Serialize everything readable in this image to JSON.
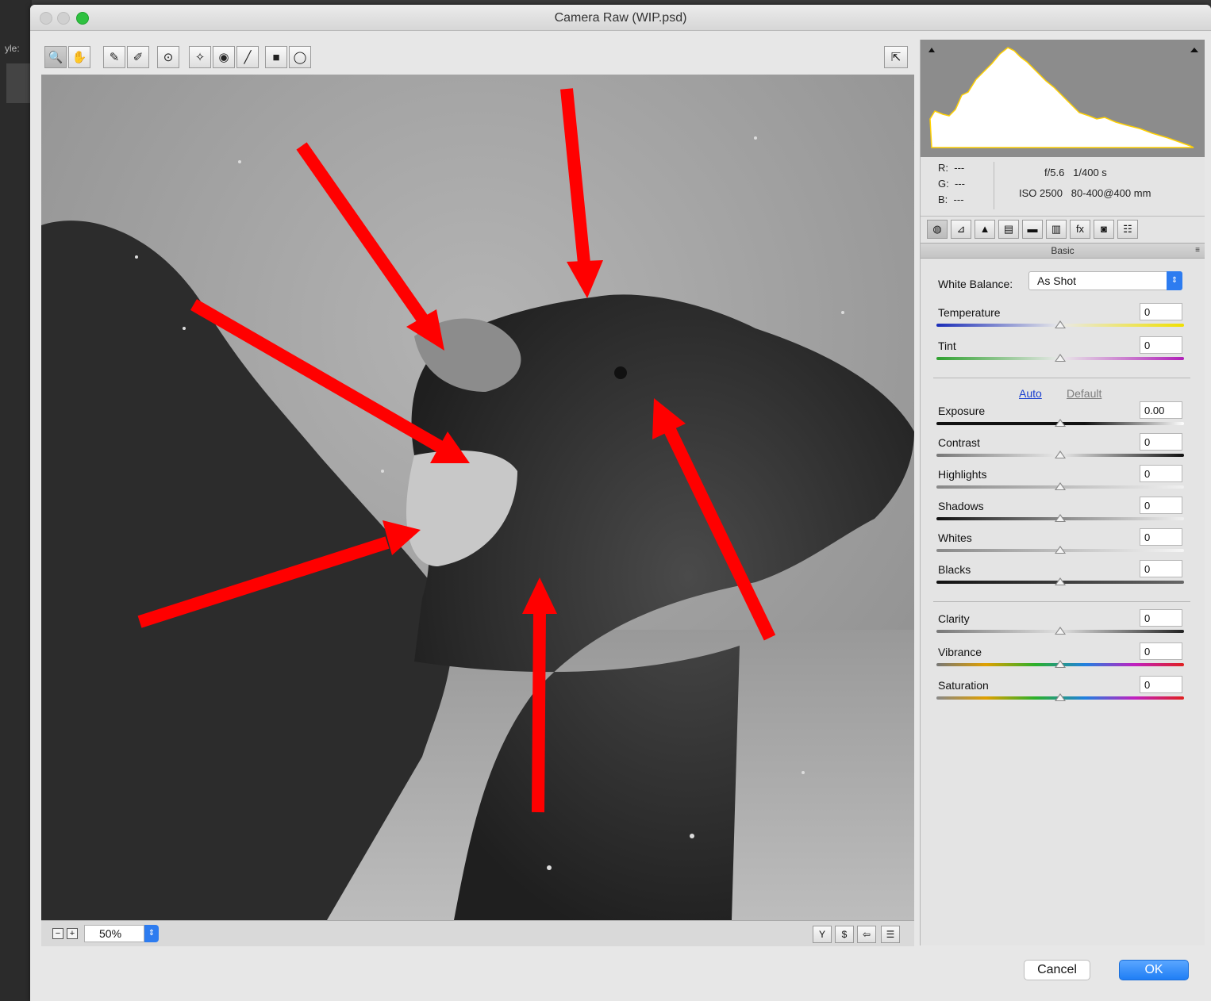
{
  "backdrop": {
    "label": "yle:"
  },
  "window": {
    "title": "Camera Raw (WIP.psd)"
  },
  "toolbar": {
    "tools": [
      {
        "icon": "zoom-tool-icon",
        "glyph": "🔍"
      },
      {
        "icon": "hand-tool-icon",
        "glyph": "✋"
      },
      {
        "icon": "white-balance-tool-icon",
        "glyph": "✎"
      },
      {
        "icon": "color-sampler-tool-icon",
        "glyph": "✐"
      },
      {
        "icon": "targeted-adjustment-tool-icon",
        "glyph": "⊙"
      },
      {
        "icon": "spot-removal-tool-icon",
        "glyph": "✧"
      },
      {
        "icon": "red-eye-tool-icon",
        "glyph": "◉"
      },
      {
        "icon": "adjustment-brush-icon",
        "glyph": "╱"
      },
      {
        "icon": "graduated-filter-icon",
        "glyph": "■"
      },
      {
        "icon": "radial-filter-icon",
        "glyph": "◯"
      }
    ],
    "preview_toggle_glyph": "⇱"
  },
  "preview": {
    "zoom_out_glyph": "−",
    "zoom_in_glyph": "+",
    "zoom_value": "50%",
    "zoom_step_glyph": "⇕",
    "view_buttons": [
      "Y",
      "$",
      "⇦",
      "☰"
    ]
  },
  "panel": {
    "readout": {
      "r_label": "R:",
      "r_value": "---",
      "g_label": "G:",
      "g_value": "---",
      "b_label": "B:",
      "b_value": "---",
      "aperture": "f/5.6",
      "shutter": "1/400 s",
      "iso": "ISO 2500",
      "lens": "80-400@400 mm"
    },
    "tabs": [
      "◍",
      "⊿",
      "▲",
      "▤",
      "▬",
      "▥",
      "fx",
      "◙",
      "☷"
    ],
    "section_title": "Basic",
    "section_menu_glyph": "≡",
    "white_balance": {
      "label": "White Balance:",
      "value": "As Shot",
      "step_glyph": "⇕"
    },
    "auto_label": "Auto",
    "default_label": "Default",
    "sliders": [
      {
        "label": "Temperature",
        "value": "0",
        "position": 0.5
      },
      {
        "label": "Tint",
        "value": "0",
        "position": 0.5
      },
      {
        "label": "Exposure",
        "value": "0.00",
        "position": 0.5
      },
      {
        "label": "Contrast",
        "value": "0",
        "position": 0.5
      },
      {
        "label": "Highlights",
        "value": "0",
        "position": 0.5
      },
      {
        "label": "Shadows",
        "value": "0",
        "position": 0.5
      },
      {
        "label": "Whites",
        "value": "0",
        "position": 0.5
      },
      {
        "label": "Blacks",
        "value": "0",
        "position": 0.5
      },
      {
        "label": "Clarity",
        "value": "0",
        "position": 0.5
      },
      {
        "label": "Vibrance",
        "value": "0",
        "position": 0.5
      },
      {
        "label": "Saturation",
        "value": "0",
        "position": 0.5
      }
    ]
  },
  "buttons": {
    "cancel": "Cancel",
    "ok": "OK"
  },
  "colors": {
    "accent": "#2d7cf0",
    "annotation_arrow": "#ff0000"
  }
}
